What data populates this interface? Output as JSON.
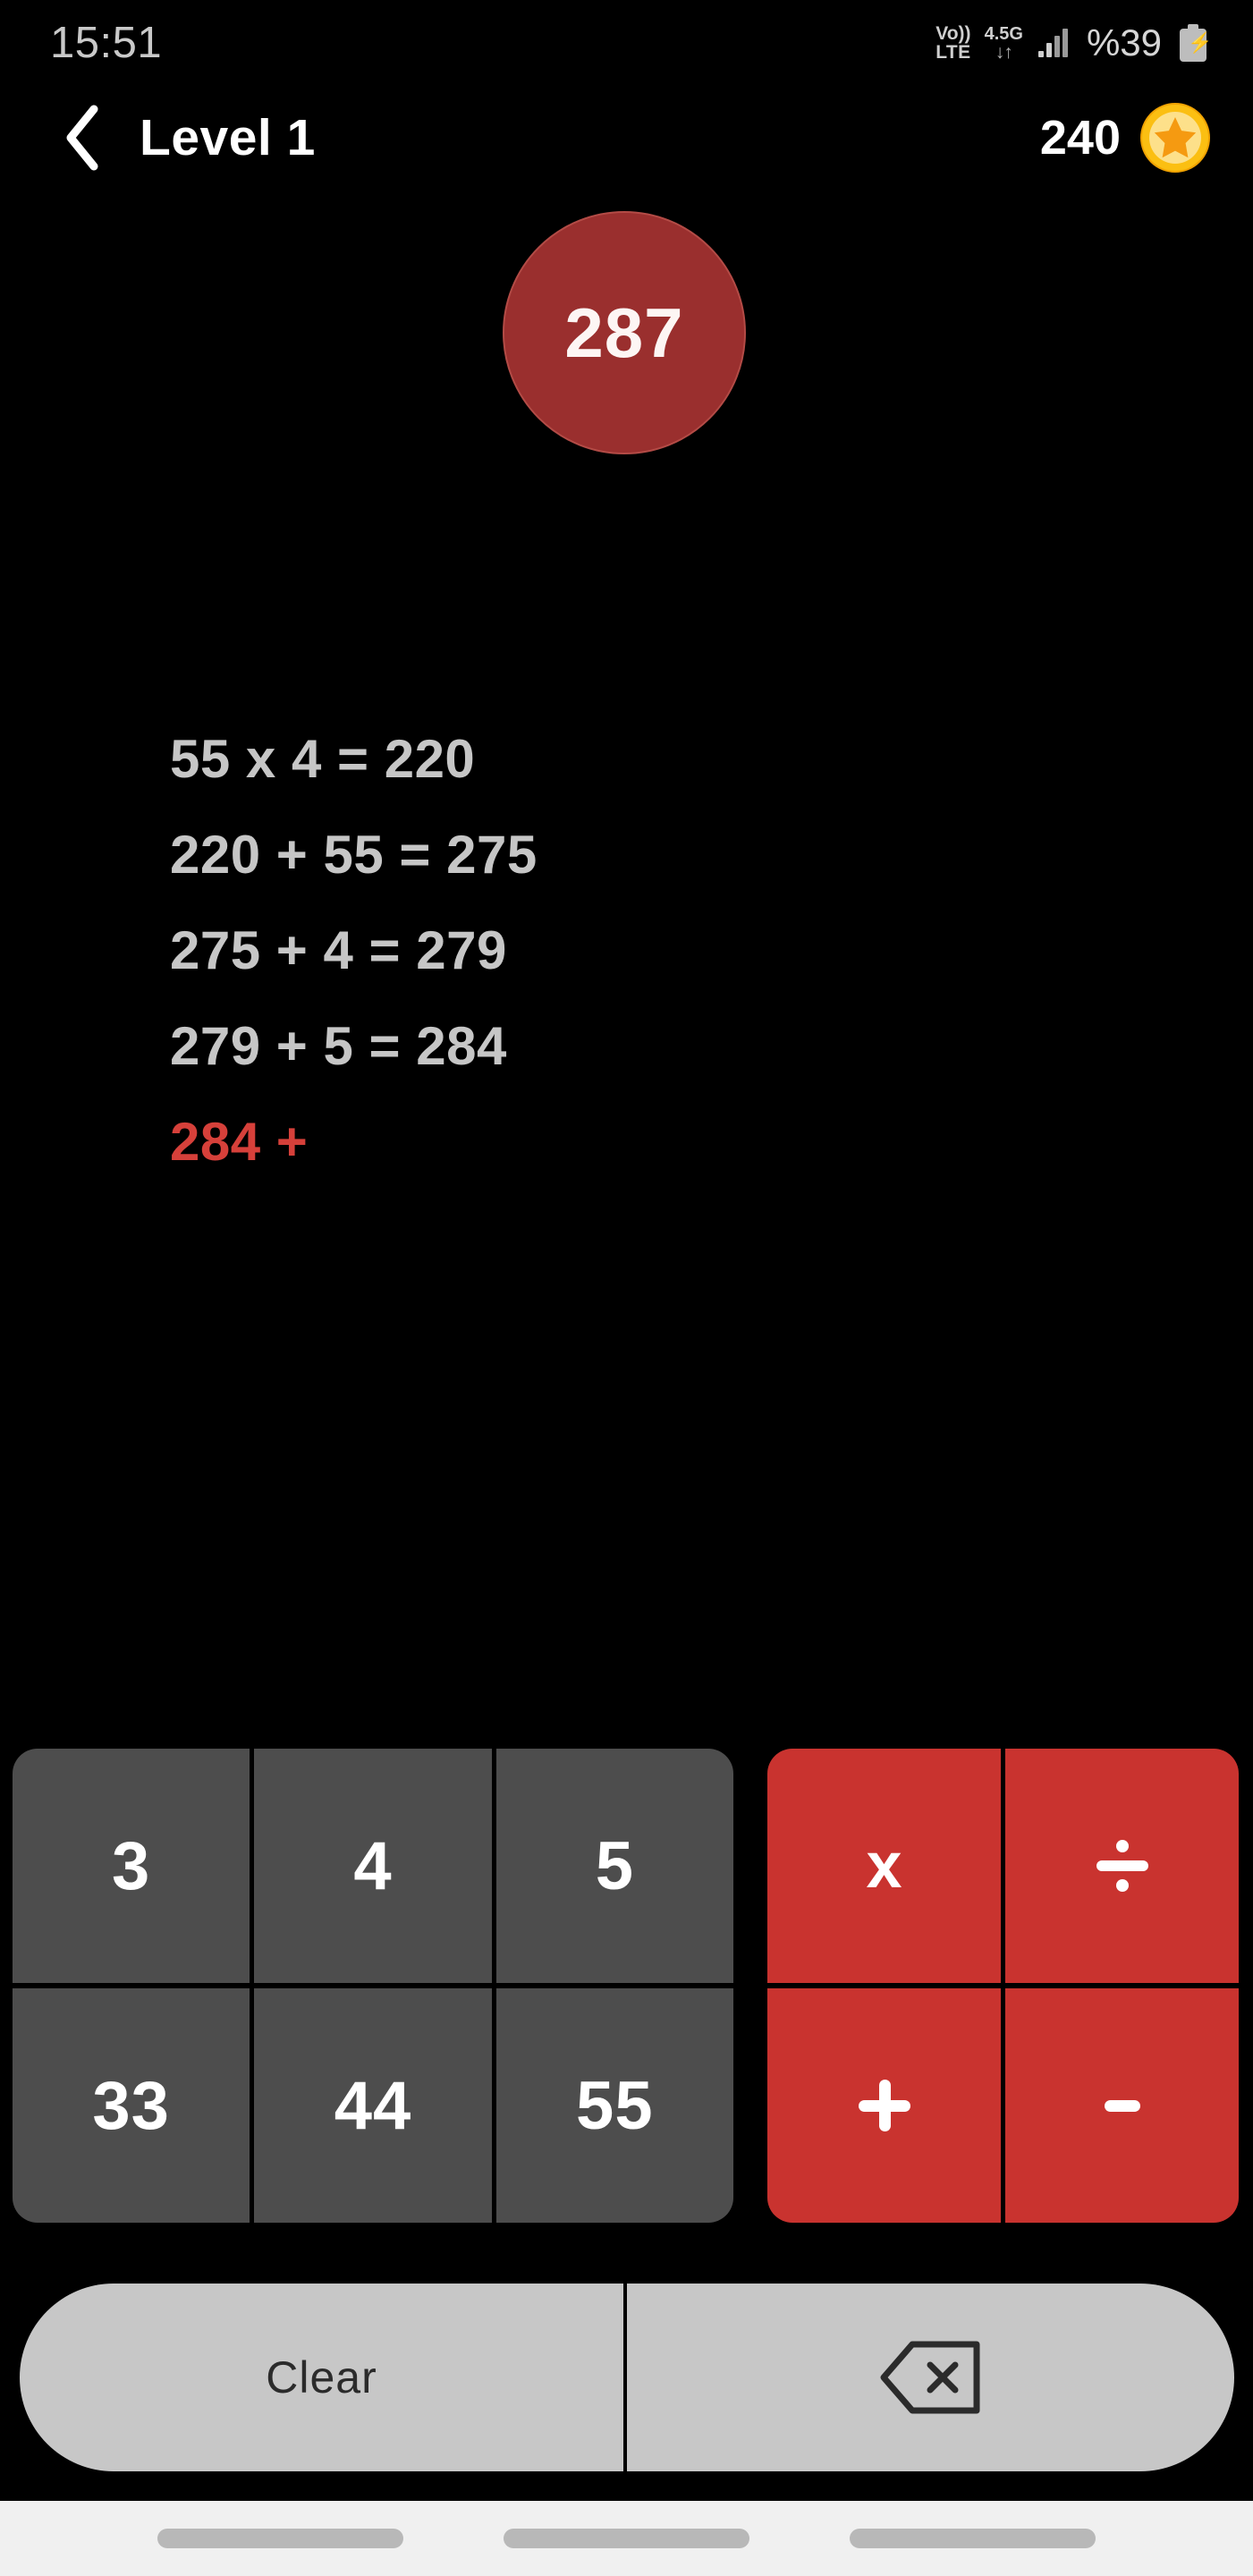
{
  "status_bar": {
    "clock": "15:51",
    "volte_line1": "Vo))",
    "volte_line2": "LTE",
    "network_type": "4.5G",
    "network_arrows": "↓↑",
    "battery_percent": "%39",
    "signal_icon": "signal-bars-icon",
    "battery_icon": "battery-charging-icon"
  },
  "header": {
    "back_icon": "back-chevron-icon",
    "title": "Level 1",
    "score": "240",
    "coin_icon": "star-coin-icon"
  },
  "target": {
    "value": "287",
    "color": "#9a2f2e"
  },
  "equations": [
    {
      "text": "55 x 4 = 220",
      "current": false
    },
    {
      "text": "220 + 55 = 275",
      "current": false
    },
    {
      "text": "275 + 4 = 279",
      "current": false
    },
    {
      "text": "279 + 5 = 284",
      "current": false
    },
    {
      "text": "284 +",
      "current": true
    }
  ],
  "keypad": {
    "numbers": [
      "3",
      "4",
      "5",
      "33",
      "44",
      "55"
    ],
    "operators": [
      {
        "label": "x",
        "glyph": "multiply-glyph",
        "name": "multiply"
      },
      {
        "label": "÷",
        "glyph": "divide-glyph",
        "name": "divide"
      },
      {
        "label": "+",
        "glyph": "plus-glyph",
        "name": "plus"
      },
      {
        "label": "−",
        "glyph": "minus-glyph",
        "name": "minus"
      }
    ],
    "number_color": "#4d4d4d",
    "operator_color": "#c9332f"
  },
  "action_bar": {
    "clear_label": "Clear",
    "backspace_icon": "backspace-icon",
    "background": "#c7c7c7"
  },
  "nav_bar": {
    "pills": [
      "recents-pill",
      "home-pill",
      "back-pill"
    ]
  }
}
